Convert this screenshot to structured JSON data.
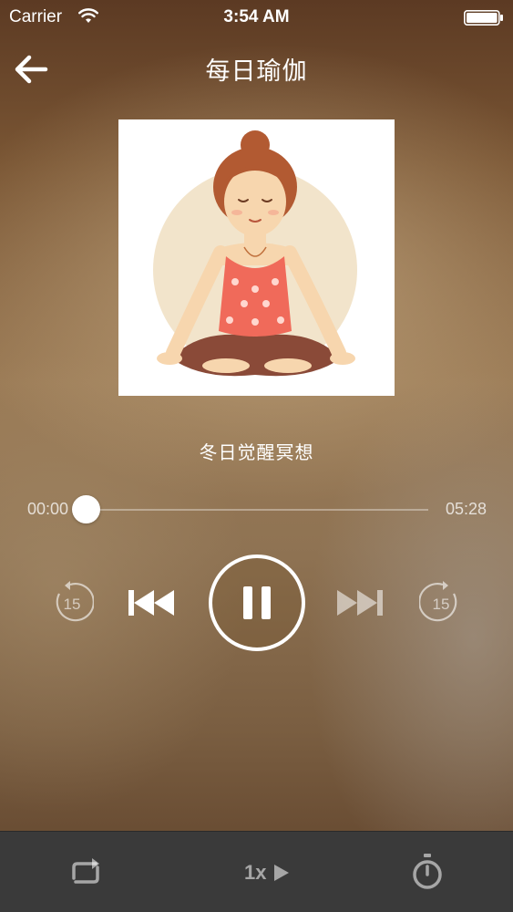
{
  "status_bar": {
    "carrier": "Carrier",
    "time": "3:54 AM",
    "icons": [
      "wifi-icon",
      "battery-icon"
    ]
  },
  "nav": {
    "title": "每日瑜伽",
    "back_icon": "arrow-left-icon"
  },
  "artwork": {
    "subject": "meditating-woman-illustration",
    "colors": {
      "background": "#ffffff",
      "halo": "#f0dfc2",
      "tank_top": "#f06a5a",
      "pants": "#8a4a38",
      "skin": "#f7d6ae",
      "hair": "#b25a32"
    }
  },
  "track": {
    "title": "冬日觉醒冥想"
  },
  "progress": {
    "current": "00:00",
    "total": "05:28",
    "fraction": 0.0
  },
  "controls": {
    "rewind_label": "15",
    "forward_label": "15",
    "rewind_icon": "rewind-15-icon",
    "prev_icon": "skip-previous-icon",
    "play_state_icon": "pause-icon",
    "next_icon": "skip-next-icon",
    "forward_icon": "forward-15-icon"
  },
  "bottom_bar": {
    "repeat_icon": "repeat-icon",
    "speed_label": "1x",
    "speed_icon": "play-triangle-icon",
    "timer_icon": "stopwatch-icon"
  },
  "theme": {
    "accent": "#ffffff",
    "bar_background": "#3a3a3a"
  }
}
